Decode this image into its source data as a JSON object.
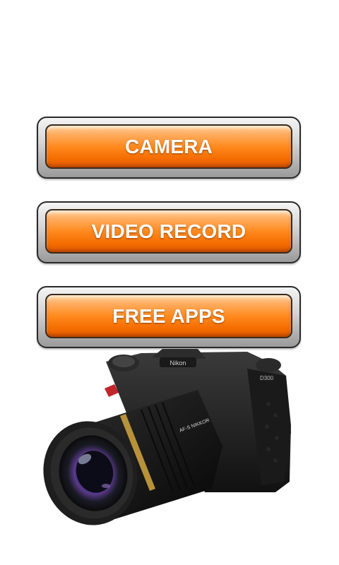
{
  "buttons": {
    "camera": "CAMERA",
    "video": "VIDEO RECORD",
    "free_apps": "FREE APPS"
  },
  "image": {
    "icon": "dslr-camera-image",
    "brand_badge": "D300"
  },
  "colors": {
    "button_orange": "#ff8a1e",
    "button_text": "#ffffff",
    "background": "#ffffff"
  }
}
